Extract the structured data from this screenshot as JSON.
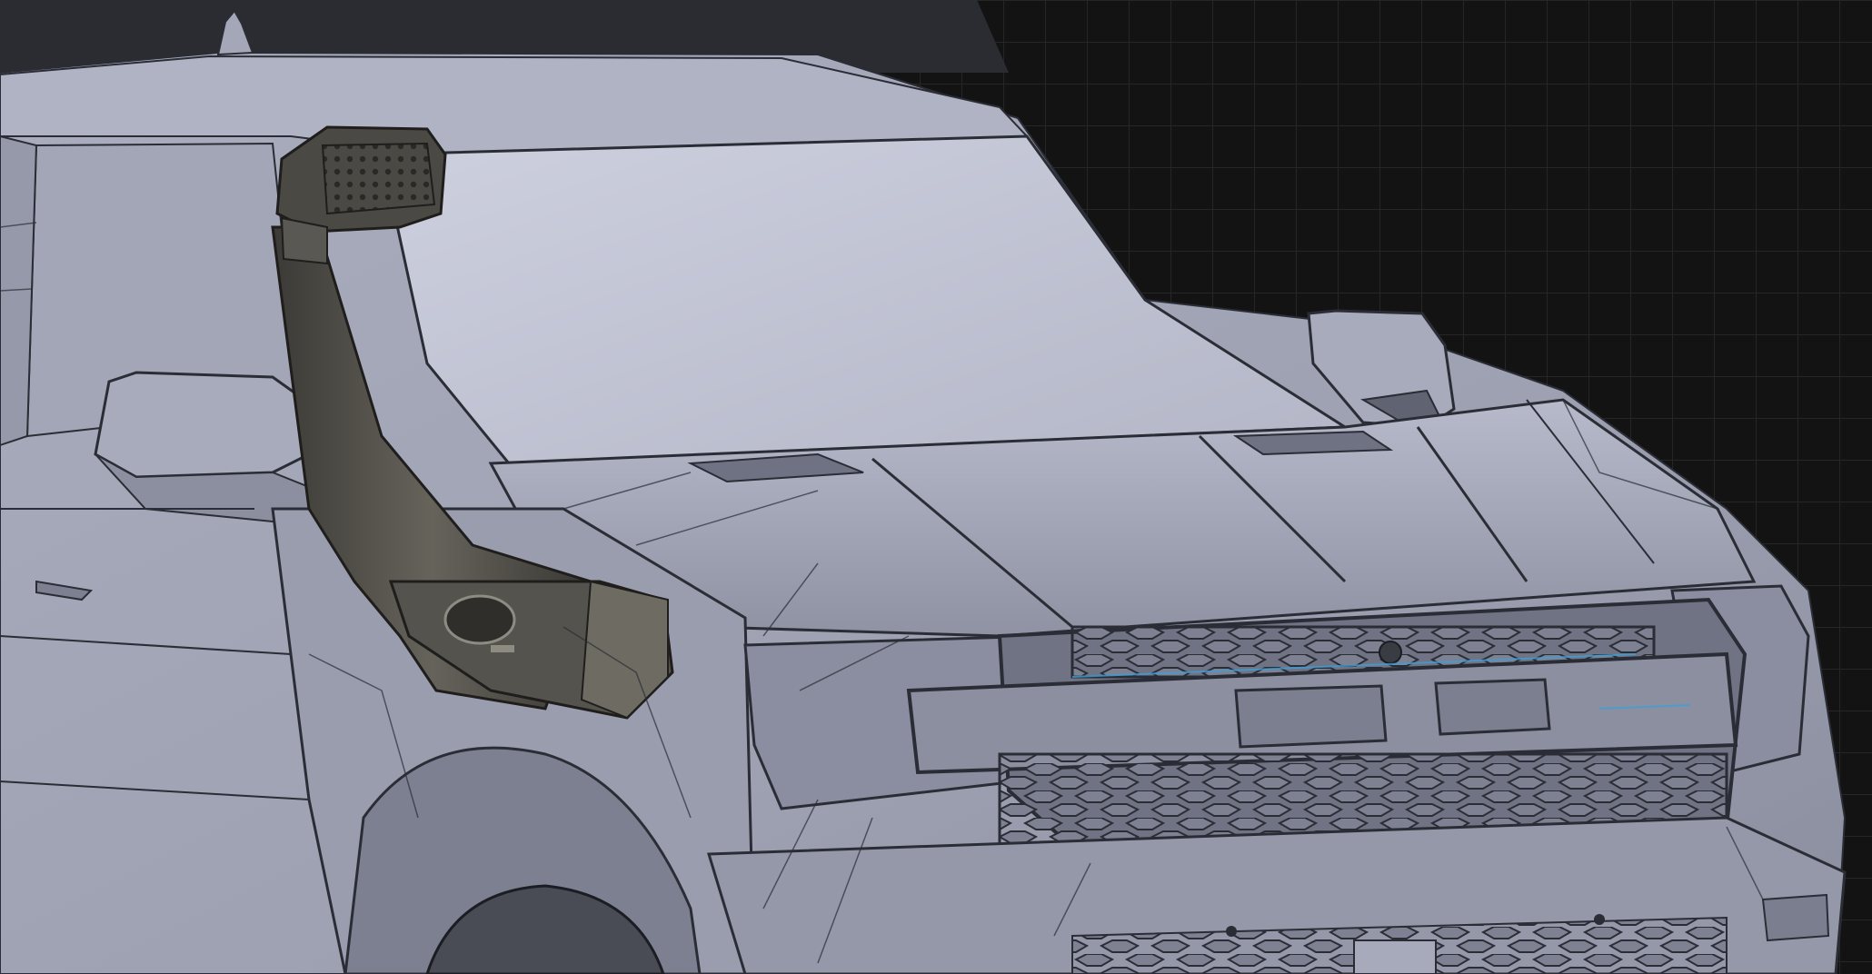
{
  "scene": {
    "subject": "",
    "brand_text": "",
    "colors": {
      "background": "#131313",
      "grid": "#262626",
      "body_light": "#b9bccc",
      "body_mid": "#8f93a3",
      "body_dark": "#5f6372",
      "windshield": "#c3c6d6",
      "snorkel": "#4b4944",
      "snorkel_highlight": "#6a675f",
      "edge_lines": "#2b2d36",
      "accent_blue": "#3f9fd6"
    }
  }
}
